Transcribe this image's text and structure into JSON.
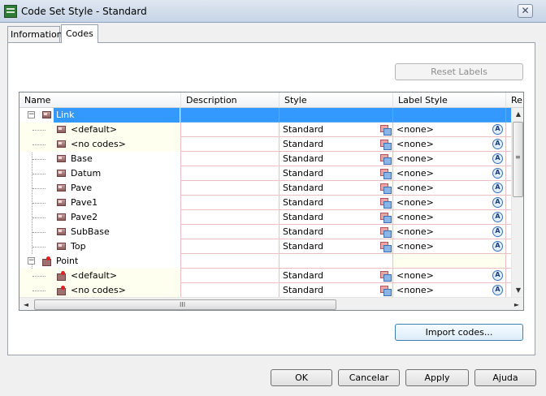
{
  "window": {
    "title": "Code Set Style - Standard",
    "close_glyph": "✕"
  },
  "tabs": [
    {
      "label": "Information",
      "selected": false
    },
    {
      "label": "Codes",
      "selected": true
    }
  ],
  "buttons": {
    "reset_labels": "Reset Labels",
    "import_codes": "Import codes...",
    "ok": "OK",
    "cancel": "Cancelar",
    "apply": "Apply",
    "help": "Ajuda"
  },
  "grid": {
    "columns": [
      "Name",
      "Description",
      "Style",
      "Label Style",
      "Re"
    ],
    "rows": [
      {
        "name": "Link",
        "description": "",
        "style": "",
        "label_style": "",
        "kind": "group-link"
      },
      {
        "name": "<default>",
        "description": "",
        "style": "Standard",
        "label_style": "<none>",
        "kind": "link-child"
      },
      {
        "name": "<no codes>",
        "description": "",
        "style": "Standard",
        "label_style": "<none>",
        "kind": "link-child"
      },
      {
        "name": "Base",
        "description": "",
        "style": "Standard",
        "label_style": "<none>",
        "kind": "link-child"
      },
      {
        "name": "Datum",
        "description": "",
        "style": "Standard",
        "label_style": "<none>",
        "kind": "link-child"
      },
      {
        "name": "Pave",
        "description": "",
        "style": "Standard",
        "label_style": "<none>",
        "kind": "link-child"
      },
      {
        "name": "Pave1",
        "description": "",
        "style": "Standard",
        "label_style": "<none>",
        "kind": "link-child"
      },
      {
        "name": "Pave2",
        "description": "",
        "style": "Standard",
        "label_style": "<none>",
        "kind": "link-child"
      },
      {
        "name": "SubBase",
        "description": "",
        "style": "Standard",
        "label_style": "<none>",
        "kind": "link-child"
      },
      {
        "name": "Top",
        "description": "",
        "style": "Standard",
        "label_style": "<none>",
        "kind": "link-child"
      },
      {
        "name": "Point",
        "description": "",
        "style": "",
        "label_style": "",
        "kind": "group-point"
      },
      {
        "name": "<default>",
        "description": "",
        "style": "Standard",
        "label_style": "<none>",
        "kind": "point-child"
      },
      {
        "name": "<no codes>",
        "description": "",
        "style": "Standard",
        "label_style": "<none>",
        "kind": "point-child"
      }
    ]
  },
  "scroll": {
    "up": "▲",
    "down": "▼",
    "left": "◄",
    "right": "►",
    "grip_v": "≡",
    "grip_h": "III"
  },
  "tree": {
    "minus": "−"
  },
  "colors": {
    "selection": "#3399ff",
    "cream": "#fffff0",
    "grid_line": "#ebc0c0"
  }
}
